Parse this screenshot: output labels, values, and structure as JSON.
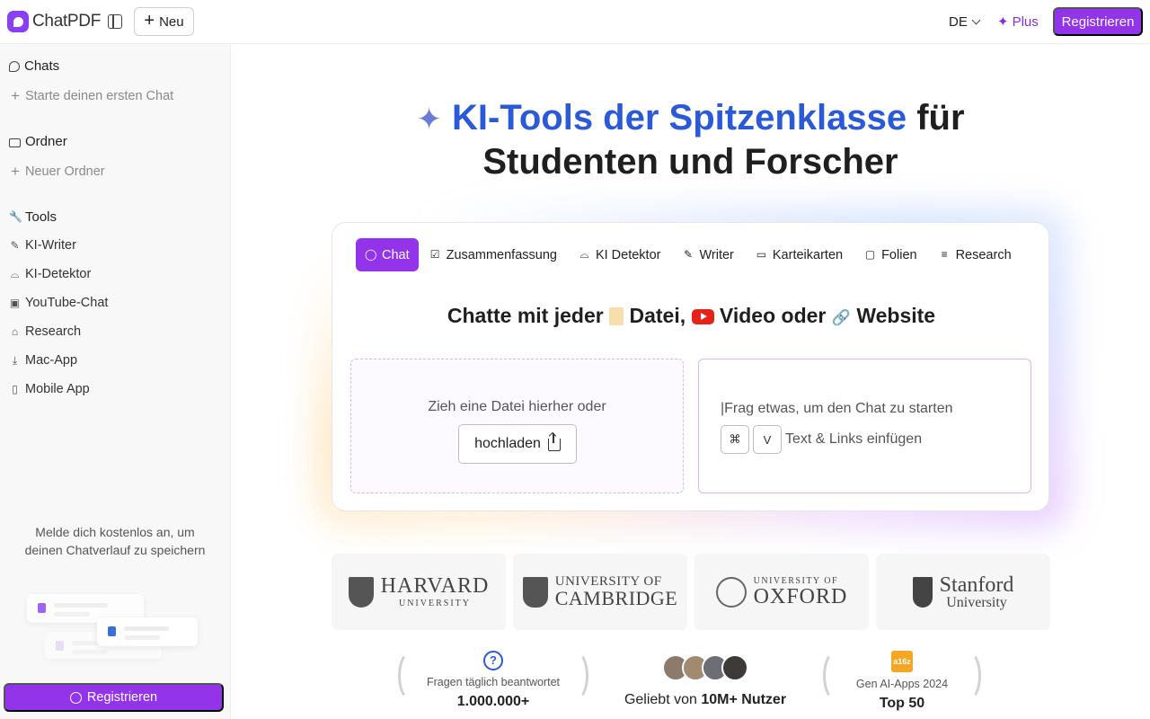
{
  "topbar": {
    "logo_text": "ChatPDF",
    "new_label": "Neu",
    "language": "DE",
    "plus_label": "Plus",
    "register_label": "Registrieren"
  },
  "sidebar": {
    "chats_heading": "Chats",
    "start_chat": "Starte deinen ersten Chat",
    "folders_heading": "Ordner",
    "new_folder": "Neuer Ordner",
    "tools_heading": "Tools",
    "tools": [
      {
        "label": "KI-Writer",
        "icon": "pencil-icon"
      },
      {
        "label": "KI-Detektor",
        "icon": "detective-icon"
      },
      {
        "label": "YouTube-Chat",
        "icon": "video-icon"
      },
      {
        "label": "Research",
        "icon": "graduation-cap-icon"
      },
      {
        "label": "Mac-App",
        "icon": "download-icon"
      },
      {
        "label": "Mobile App",
        "icon": "smartphone-icon"
      }
    ],
    "promo_text": "Melde dich kostenlos an, um deinen Chatverlauf zu speichern",
    "register_label": "Registrieren"
  },
  "hero": {
    "highlight": "KI-Tools der Spitzenklasse",
    "rest_line1": "für",
    "line2": "Studenten und Forscher"
  },
  "tabs": [
    {
      "label": "Chat",
      "icon": "chat-bubble-icon",
      "active": true
    },
    {
      "label": "Zusammenfassung",
      "icon": "checklist-icon",
      "active": false
    },
    {
      "label": "KI Detektor",
      "icon": "detective-icon",
      "active": false
    },
    {
      "label": "Writer",
      "icon": "pencil-icon",
      "active": false
    },
    {
      "label": "Karteikarten",
      "icon": "card-icon",
      "active": false
    },
    {
      "label": "Folien",
      "icon": "presentation-icon",
      "active": false
    },
    {
      "label": "Research",
      "icon": "search-list-icon",
      "active": false
    }
  ],
  "panel": {
    "title_part1": "Chatte mit jeder",
    "title_part2": "Datei,",
    "title_part3": "Video oder",
    "title_part4": "Website",
    "drop_text": "Zieh eine Datei hierher oder",
    "upload_label": "hochladen",
    "ask_placeholder": "|Frag etwas, um den Chat zu starten",
    "key_cmd": "⌘",
    "key_v": "V",
    "paste_text": "Text & Links einfügen"
  },
  "universities": {
    "harvard": {
      "line1": "HARVARD",
      "line2": "UNIVERSITY"
    },
    "cambridge": {
      "line1": "UNIVERSITY OF",
      "line2": "CAMBRIDGE"
    },
    "oxford": {
      "line1": "UNIVERSITY OF",
      "line2": "OXFORD"
    },
    "stanford": {
      "line1": "Stanford",
      "line2": "University"
    }
  },
  "stats": {
    "answered_label": "Fragen täglich beantwortet",
    "answered_value": "1.000.000+",
    "loved_prefix": "Geliebt von",
    "loved_value": "10M+ Nutzer",
    "a16z_badge": "a16z",
    "genai_label": "Gen AI-Apps 2024",
    "genai_value": "Top 50"
  },
  "colors": {
    "accent": "#9333ea",
    "hero_blue": "#2b5ad8",
    "youtube_red": "#e62117"
  }
}
